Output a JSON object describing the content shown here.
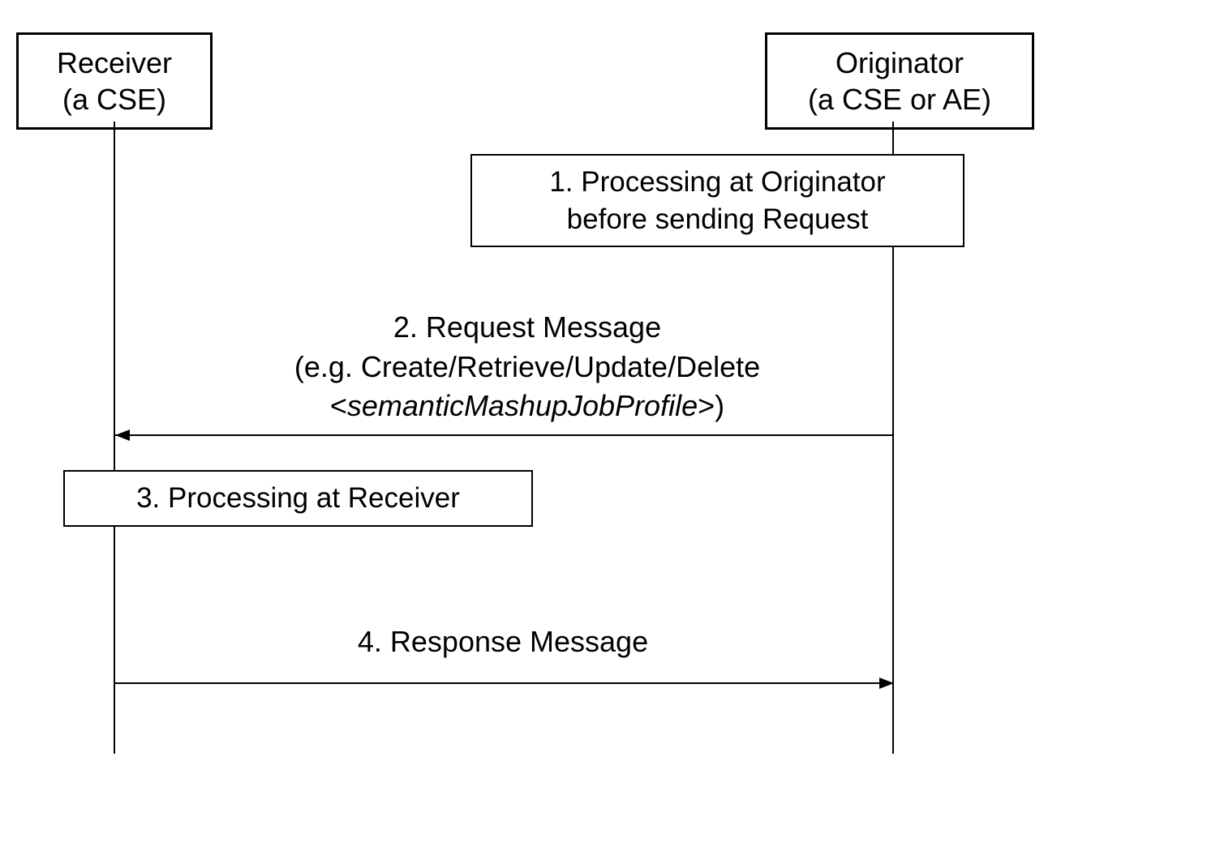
{
  "actors": {
    "receiver": {
      "name": "Receiver",
      "subtitle": "(a CSE)"
    },
    "originator": {
      "name": "Originator",
      "subtitle": "(a CSE or AE)"
    }
  },
  "steps": {
    "step1": {
      "line1": "1. Processing at Originator",
      "line2": "before sending Request"
    },
    "step2": {
      "line1": "2. Request Message",
      "line2": "(e.g. Create/Retrieve/Update/Delete",
      "line3_open": "<",
      "line3_italic": "semanticMashupJobProfile",
      "line3_close": ">)"
    },
    "step3": {
      "text": "3. Processing at Receiver"
    },
    "step4": {
      "text": "4. Response Message"
    }
  }
}
